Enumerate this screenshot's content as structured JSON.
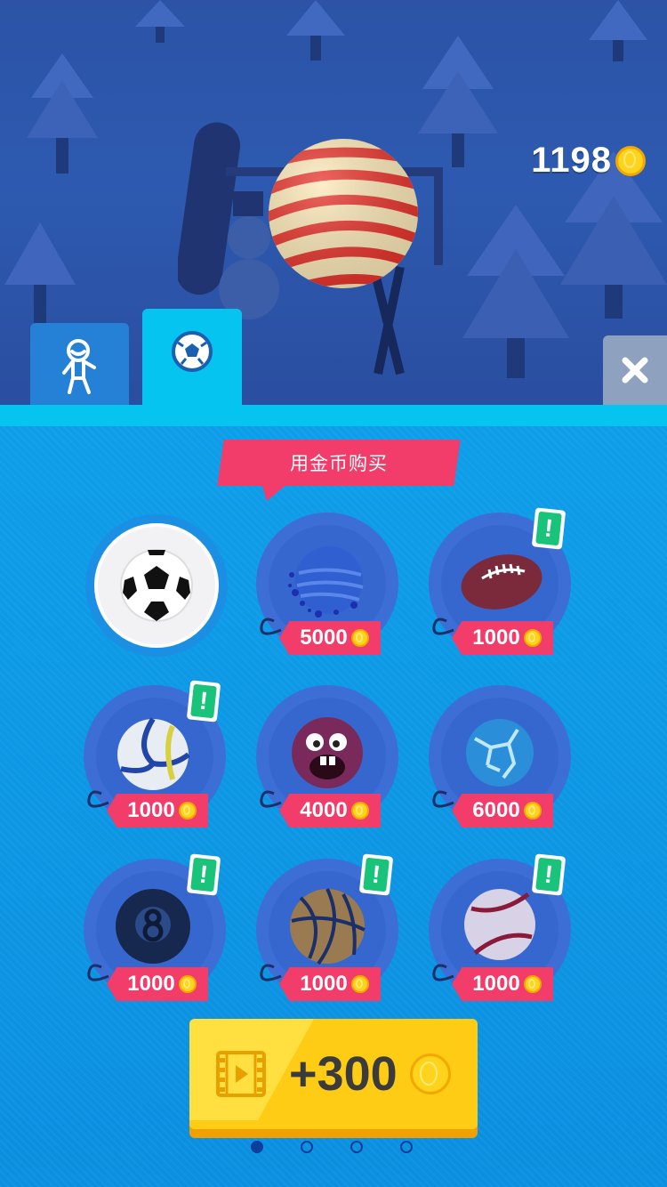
{
  "hud": {
    "coins": "1198",
    "coin_icon": "gold-coin-icon"
  },
  "preview": {
    "ball": "candy-stripe-ball"
  },
  "tabs": [
    {
      "icon": "character-icon",
      "active": false
    },
    {
      "icon": "soccer-ball-icon",
      "active": true
    }
  ],
  "close_icon": "close-icon",
  "shop": {
    "banner": "用金币购买",
    "balls": [
      {
        "name": "soccer-ball",
        "owned": true,
        "price": "",
        "new": false
      },
      {
        "name": "planet-ball",
        "owned": false,
        "price": "5000",
        "new": false
      },
      {
        "name": "rugby-ball",
        "owned": false,
        "price": "1000",
        "new": true
      },
      {
        "name": "volleyball",
        "owned": false,
        "price": "1000",
        "new": true
      },
      {
        "name": "monster-ball",
        "owned": false,
        "price": "4000",
        "new": false
      },
      {
        "name": "ice-ball",
        "owned": false,
        "price": "6000",
        "new": false
      },
      {
        "name": "eight-ball",
        "owned": false,
        "price": "1000",
        "new": true
      },
      {
        "name": "basketball",
        "owned": false,
        "price": "1000",
        "new": true
      },
      {
        "name": "baseball",
        "owned": false,
        "price": "1000",
        "new": true
      }
    ],
    "new_badge": "!"
  },
  "video_reward": {
    "label": "+300",
    "icon": "video-film-icon"
  },
  "pagination": {
    "pages": 4,
    "current": 1
  },
  "colors": {
    "accent_pink": "#f23c6a",
    "gold": "#ffcc15",
    "tab_active": "#06c4f0"
  }
}
